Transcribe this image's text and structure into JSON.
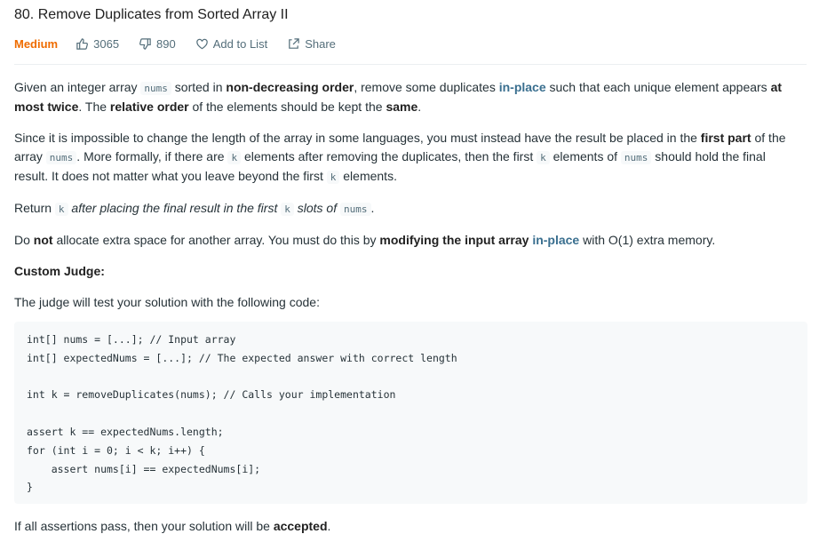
{
  "problem": {
    "title": "80. Remove Duplicates from Sorted Array II",
    "difficulty": "Medium",
    "likes": "3065",
    "dislikes": "890",
    "add_to_list": "Add to List",
    "share": "Share"
  },
  "description": {
    "p1": {
      "t1": "Given an integer array ",
      "c1": "nums",
      "t2": " sorted in ",
      "b1": "non-decreasing order",
      "t3": ", remove some duplicates ",
      "b2": "in-place",
      "t4": " such that each unique element appears ",
      "b3": "at most twice",
      "t5": ". The ",
      "b4": "relative order",
      "t6": " of the elements should be kept the ",
      "b5": "same",
      "t7": "."
    },
    "p2": {
      "t1": "Since it is impossible to change the length of the array in some languages, you must instead have the result be placed in the ",
      "b1": "first part",
      "t2": " of the array ",
      "c1": "nums",
      "t3": ". More formally, if there are ",
      "c2": "k",
      "t4": " elements after removing the duplicates, then the first ",
      "c3": "k",
      "t5": " elements of ",
      "c4": "nums",
      "t6": " should hold the final result. It does not matter what you leave beyond the first ",
      "c5": "k",
      "t7": " elements."
    },
    "p3": {
      "t1": "Return ",
      "c1": "k",
      "e1": " after placing the final result in the first ",
      "c2": "k",
      "e2": " slots of ",
      "c3": "nums",
      "t2": "."
    },
    "p4": {
      "t1": "Do ",
      "b1": "not",
      "t2": " allocate extra space for another array. You must do this by ",
      "b2": "modifying the input array",
      "t3": " ",
      "b3": "in-place",
      "t4": " with O(1) extra memory."
    },
    "custom_judge_heading": "Custom Judge:",
    "judge_intro": "The judge will test your solution with the following code:",
    "code": "int[] nums = [...]; // Input array\nint[] expectedNums = [...]; // The expected answer with correct length\n\nint k = removeDuplicates(nums); // Calls your implementation\n\nassert k == expectedNums.length;\nfor (int i = 0; i < k; i++) {\n    assert nums[i] == expectedNums[i];\n}",
    "p5": {
      "t1": "If all assertions pass, then your solution will be ",
      "b1": "accepted",
      "t2": "."
    }
  }
}
